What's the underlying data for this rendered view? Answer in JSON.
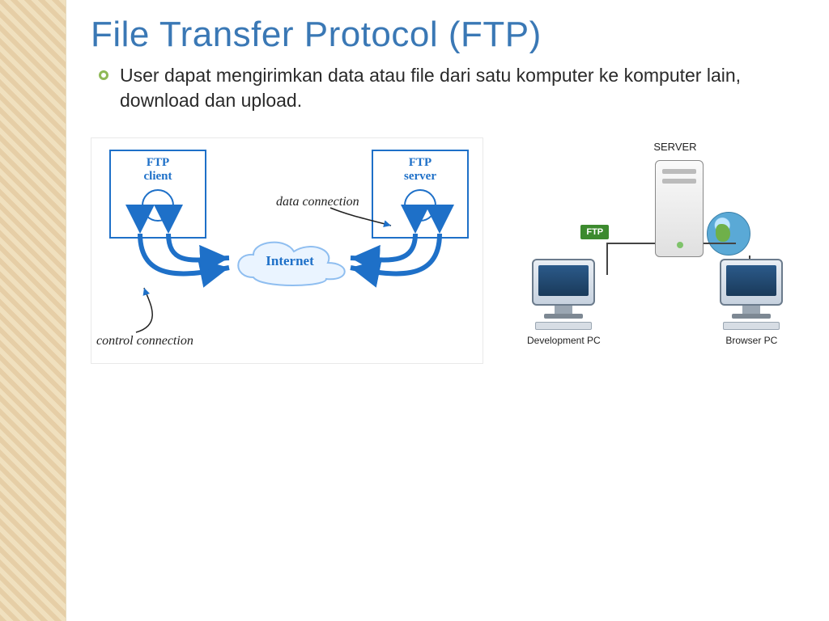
{
  "title": "File Transfer Protocol (FTP)",
  "bullet": "User dapat mengirimkan data atau file dari satu komputer ke komputer lain, download dan upload.",
  "diagramA": {
    "client_line1": "FTP",
    "client_line2": "client",
    "server_line1": "FTP",
    "server_line2": "server",
    "internet": "Internet",
    "data_connection": "data connection",
    "control_connection": "control connection"
  },
  "diagramB": {
    "server": "SERVER",
    "ftp": "FTP",
    "dev_pc": "Development PC",
    "browser_pc": "Browser PC"
  }
}
